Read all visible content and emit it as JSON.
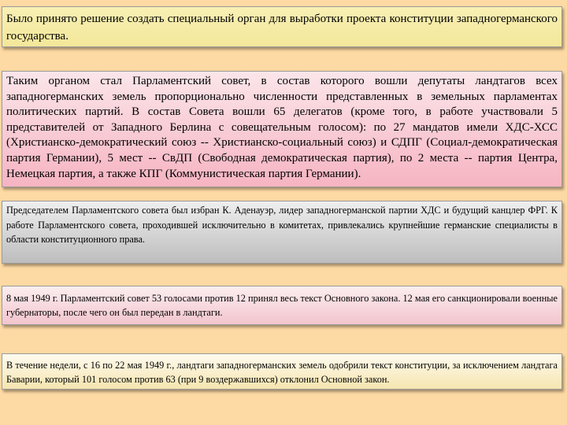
{
  "slide": {
    "blocks": [
      {
        "text": "Было принято решение создать специальный орган для выработки проекта конституции западногерманского государства."
      },
      {
        "text": "Таким органом стал Парламентский совет, в состав которого вошли депутаты ландтагов всех западногерманских земель пропорционально численности представленных в земельных парламентах политических партий. В состав Совета вошли 65 делегатов (кроме того, в работе участвовали 5 представителей от Западного Берлина с совещательным голосом): по 27 мандатов имели ХДС-ХСС (Христианско-демократический союз -- Христианско-социальный союз) и СДПГ (Социал-демократическая партия Германии), 5 мест -- СвДП (Свободная демократическая партия), по 2 места -- партия Центра, Немецкая партия, а также КПГ (Коммунистическая партия Германии)."
      },
      {
        "text": "Председателем Парламентского совета был избран К. Аденауэр, лидер западногерманской партии ХДС и будущий канцлер ФРГ. К работе Парламентского совета, проходившей исключительно в комитетах, привлекались крупнейшие германские специалисты в области конституционного права."
      },
      {
        "text": "8 мая 1949 г. Парламентский совет 53 голосами против 12 принял весь текст Основного закона. 12 мая его санкционировали военные губернаторы, после чего он был передан в ландтаги."
      },
      {
        "text": "В течение недели, с 16 по 22 мая 1949 г., ландтаги западногерманских земель одобрили текст конституции, за исключением ландтага Баварии, который 101 голосом против 63 (при 9 воздержавшихся) отклонил Основной закон."
      }
    ]
  },
  "colors": {
    "background": "#fdd9a3",
    "block1": "#f5ebaa",
    "block2": "#f6b4c2",
    "block3": "#bdbdbd",
    "block4": "#f3c5cd",
    "block5": "#f6e5b0"
  }
}
